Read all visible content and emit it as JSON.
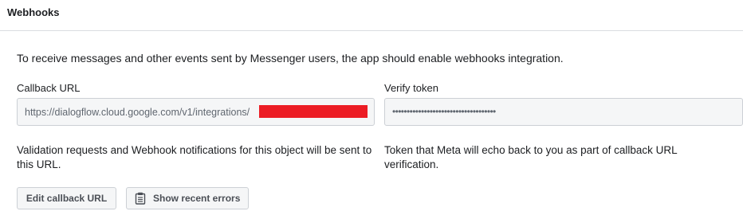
{
  "header": {
    "title": "Webhooks"
  },
  "intro": "To receive messages and other events sent by Messenger users, the app should enable webhooks integration.",
  "callback": {
    "label": "Callback URL",
    "value": "https://dialogflow.cloud.google.com/v1/integrations/",
    "help": "Validation requests and Webhook notifications for this object will be sent to this URL."
  },
  "verify": {
    "label": "Verify token",
    "value": "••••••••••••••••••••••••••••••••••••",
    "help": "Token that Meta will echo back to you as part of callback URL verification."
  },
  "buttons": {
    "edit_label": "Edit callback URL",
    "errors_label": "Show recent errors"
  },
  "colors": {
    "redaction": "#ec1c24",
    "field_bg": "#f5f6f7",
    "border": "#ccd0d5"
  },
  "icons": {
    "errors_button_icon": "clipboard-icon"
  }
}
